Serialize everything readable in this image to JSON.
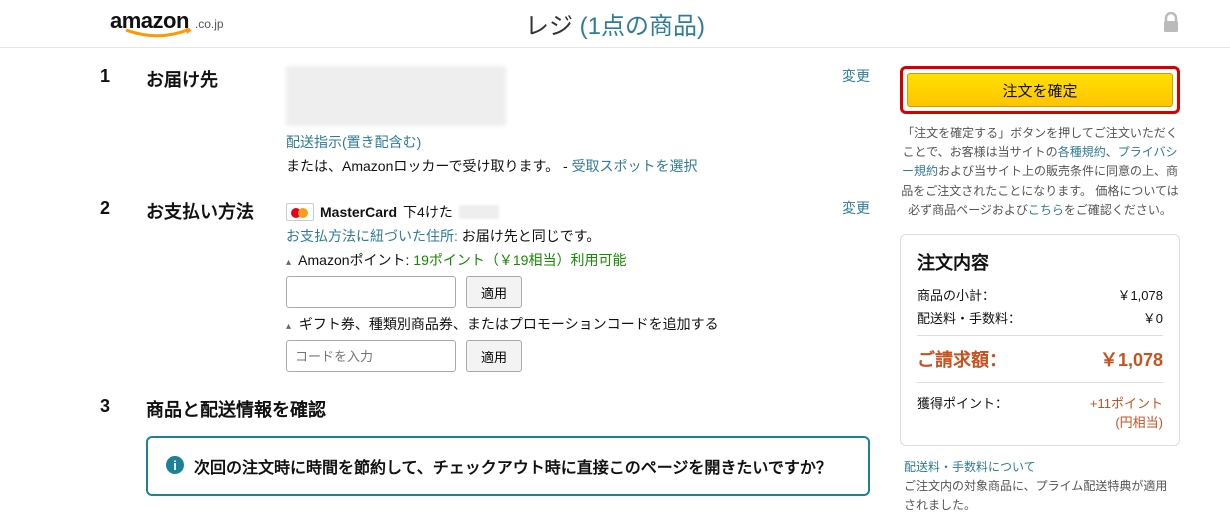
{
  "logo": {
    "brand": "amazon",
    "suffix": ".co.jp"
  },
  "header": {
    "title_prefix": "レジ",
    "item_count_text": "(1点の商品)"
  },
  "sections": {
    "s1": {
      "num": "1",
      "title": "お届け先",
      "change": "変更",
      "delivery_link": "配送指示(置き配含む)",
      "locker_text": "または、Amazonロッカーで受け取ります。 - ",
      "locker_link": "受取スポットを選択"
    },
    "s2": {
      "num": "2",
      "title": "お支払い方法",
      "card_brand": "MasterCard",
      "card_last4_label": " 下4けた ",
      "change": "変更",
      "addr_link": "お支払方法に紐づいた住所:",
      "addr_tail": " お届け先と同じです。",
      "points_prefix": "Amazonポイント: ",
      "points_value": "19ポイント（￥19相当）利用可能",
      "apply1": "適用",
      "gift_toggle": "ギフト券、種類別商品券、またはプロモーションコードを追加する",
      "code_placeholder": "コードを入力",
      "apply2": "適用"
    },
    "s3": {
      "num": "3",
      "title": "商品と配送情報を確認",
      "promo": "次回の注文時に時間を節約して、チェックアウト時に直接このページを開きたいですか？"
    }
  },
  "right": {
    "order_btn": "注文を確定",
    "legal_1": "「注文を確定する」ボタンを押してご注文いただくことで、お客様は当サイトの",
    "legal_link1": "各種規約",
    "legal_sep1": "、",
    "legal_link2": "プライバシー規約",
    "legal_2": "および当サイト上の販売条件に同意の上、商品をご注文されたことになります。 価格については必ず商品ページおよび",
    "legal_link3": "こちら",
    "legal_3": "をご確認ください。",
    "summary_title": "注文内容",
    "subtotal_label": "商品の小計：",
    "subtotal_value": "￥1,078",
    "ship_label": "配送料・手数料：",
    "ship_value": "￥0",
    "total_label": "ご請求額：",
    "total_value": "￥1,078",
    "points_label": "獲得ポイント：",
    "points_value": "+11ポイント",
    "points_sub": "(円相当)",
    "shipnote_link": "配送料・手数料について",
    "shipnote_text": "ご注文内の対象商品に、プライム配送特典が適用されました。"
  }
}
